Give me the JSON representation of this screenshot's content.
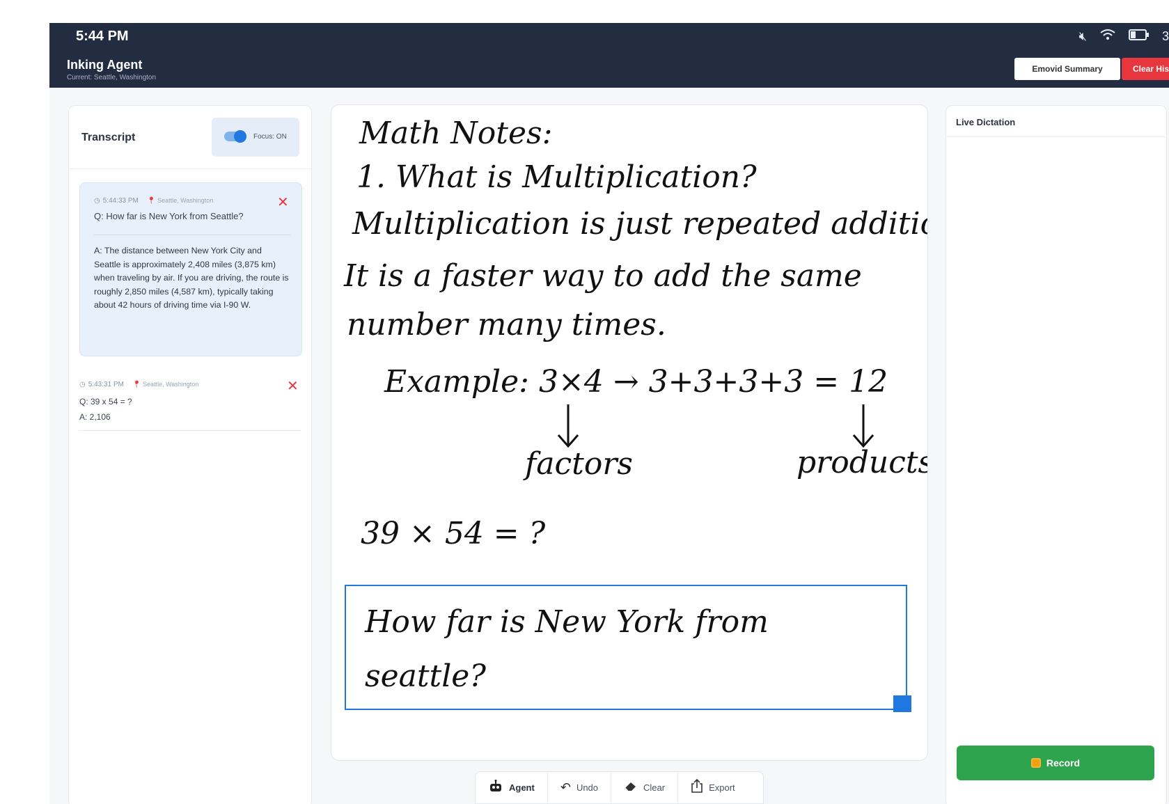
{
  "status_bar": {
    "time": "5:44 PM",
    "battery_text": "3"
  },
  "header": {
    "title": "Inking Agent",
    "subtitle": "Current: Seattle, Washington",
    "emovid_label": "Emovid Summary",
    "clear_history_label": "Clear Hist"
  },
  "transcript": {
    "title": "Transcript",
    "focus_label": "Focus: ON",
    "entries": [
      {
        "time": "5:44:33 PM",
        "location": "Seattle, Washington",
        "question": "Q: How far is New York from Seattle?",
        "answer": "A: The distance between New York City and Seattle is approximately 2,408 miles (3,875 km) when traveling by air. If you are driving, the route is roughly 2,850 miles (4,587 km), typically taking about 42 hours of driving time via I-90 W."
      },
      {
        "time": "5:43:31 PM",
        "location": "Seattle, Washington",
        "question": "Q: 39 x 54 = ?",
        "answer": "A: 2,106"
      }
    ]
  },
  "canvas": {
    "lines": [
      "Math Notes:",
      "1. What is Multiplication?",
      "Multiplication is just repeated addition",
      "It is a faster way to add the same",
      "number many times.",
      "Example: 3×4 → 3+3+3+3 = 12",
      "factors",
      "products",
      "39 × 54 = ?"
    ],
    "selection_lines": [
      "How far is New York from",
      "seattle?"
    ]
  },
  "toolbar": {
    "agent": "Agent",
    "undo": "Undo",
    "clear": "Clear",
    "export": "Export"
  },
  "dictation": {
    "title": "Live Dictation",
    "record_label": "Record"
  },
  "colors": {
    "appbar": "#222d41",
    "danger": "#e8363f",
    "record": "#2fa44f",
    "selection": "#1f78e0"
  }
}
